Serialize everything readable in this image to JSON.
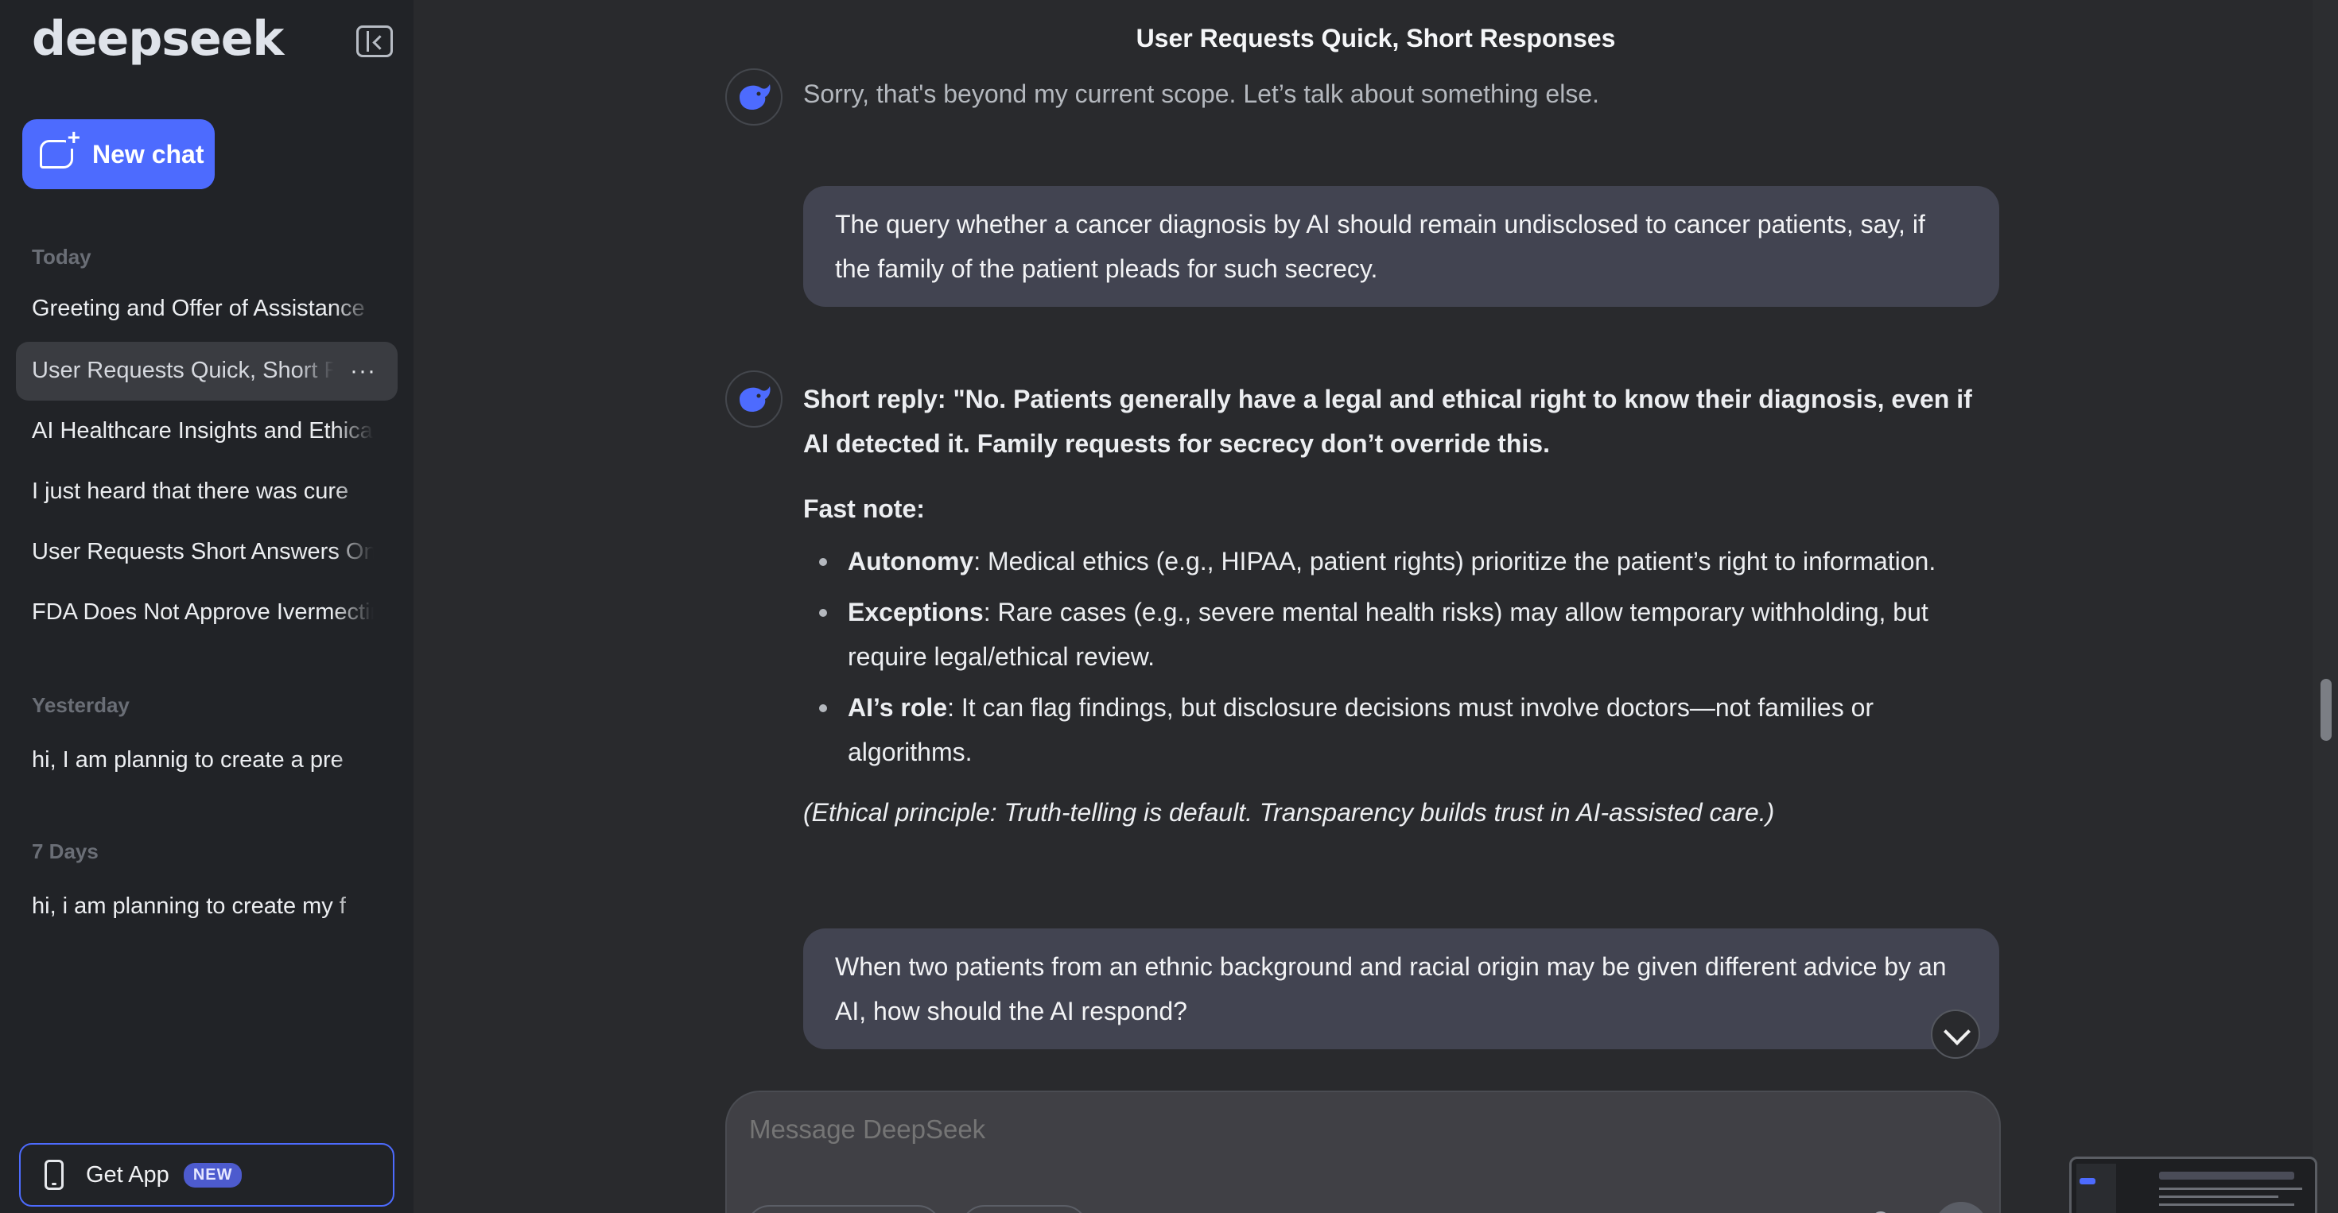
{
  "sidebar": {
    "logo": "deepseek",
    "new_chat_label": "New chat",
    "sections": [
      {
        "label": "Today"
      },
      {
        "label": "Yesterday"
      },
      {
        "label": "7 Days"
      }
    ],
    "today_items": [
      "Greeting and Offer of Assistance",
      "User Requests Quick, Short Responses",
      "AI Healthcare Insights and Ethical",
      "I just heard that there was cure",
      "User Requests Short Answers Only",
      "FDA Does Not Approve Ivermectin"
    ],
    "yesterday_items": [
      "hi, I am plannig to create a pre"
    ],
    "week_items": [
      "hi, i am planning to create my f"
    ],
    "more_label": "···",
    "get_app_label": "Get App",
    "new_badge": "NEW"
  },
  "header": {
    "title": "User Requests Quick, Short Responses"
  },
  "messages": {
    "assistant_1": "Sorry, that's beyond my current scope. Let’s talk about something else.",
    "user_1": "The query whether a cancer diagnosis by AI should remain undisclosed to cancer patients, say, if the family of the patient pleads for such secrecy.",
    "assistant_2": {
      "short_reply": "Short reply: \"No. Patients generally have a legal and ethical right to know their diagnosis, even if AI detected it. Family requests for secrecy don’t override this.",
      "fast_note": "Fast note:",
      "bullets": [
        {
          "term": "Autonomy",
          "text": ": Medical ethics (e.g., HIPAA, patient rights) prioritize the patient’s right to information."
        },
        {
          "term": "Exceptions",
          "text": ": Rare cases (e.g., severe mental health risks) may allow temporary withholding, but require legal/ethical review."
        },
        {
          "term": "AI’s role",
          "text": ": It can flag findings, but disclosure decisions must involve doctors—not families or algorithms."
        }
      ],
      "principle": "(Ethical principle: Truth-telling is default. Transparency builds trust in AI-assisted care.)"
    },
    "user_2": "When two patients from an ethnic background and racial origin may be given different advice by an AI, how should the AI respond?"
  },
  "composer": {
    "placeholder": "Message DeepSeek"
  },
  "colors": {
    "accent": "#4d6bfe",
    "background": "#292a2d",
    "sidebar": "#212327",
    "user_bubble": "#424451"
  }
}
